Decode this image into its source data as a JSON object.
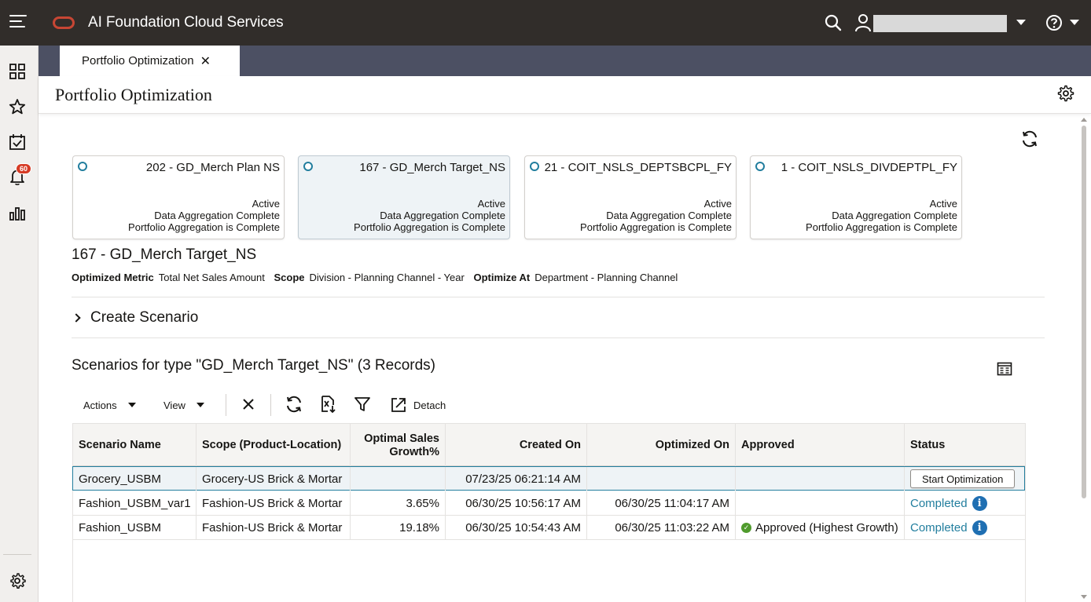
{
  "app": {
    "title": "AI Foundation Cloud Services"
  },
  "header": {
    "user_name": ""
  },
  "tabs": [
    {
      "label": "Portfolio Optimization",
      "close": "✕"
    }
  ],
  "page": {
    "title": "Portfolio Optimization"
  },
  "notifications": {
    "count": "60"
  },
  "cards": [
    {
      "title": "202 - GD_Merch Plan NS",
      "status1": "Active",
      "status2": "Data Aggregation Complete",
      "status3": "Portfolio Aggregation is Complete",
      "selected": false
    },
    {
      "title": "167 - GD_Merch Target_NS",
      "status1": "Active",
      "status2": "Data Aggregation Complete",
      "status3": "Portfolio Aggregation is Complete",
      "selected": true
    },
    {
      "title": "21 - COIT_NSLS_DEPTSBCPL_FY",
      "status1": "Active",
      "status2": "Data Aggregation Complete",
      "status3": "Portfolio Aggregation is Complete",
      "selected": false
    },
    {
      "title": "1 - COIT_NSLS_DIVDEPTPL_FY",
      "status1": "Active",
      "status2": "Data Aggregation Complete",
      "status3": "Portfolio Aggregation is Complete",
      "selected": false
    }
  ],
  "selected": {
    "title": "167 - GD_Merch Target_NS",
    "metric_label": "Optimized Metric",
    "metric_value": "Total Net Sales Amount",
    "scope_label": "Scope",
    "scope_value": "Division - Planning Channel - Year",
    "optimize_label": "Optimize At",
    "optimize_value": "Department - Planning Channel"
  },
  "create_scenario": {
    "label": "Create Scenario"
  },
  "scenarios": {
    "title": "Scenarios for type \"GD_Merch Target_NS\" (3 Records)",
    "toolbar": {
      "actions": "Actions",
      "view": "View",
      "detach": "Detach"
    },
    "columns": [
      "Scenario Name",
      "Scope (Product-Location)",
      "Optimal Sales Growth%",
      "Created On",
      "Optimized On",
      "Approved",
      "Status"
    ],
    "rows": [
      {
        "name": "Grocery_USBM",
        "scope": "Grocery-US Brick & Mortar",
        "growth": "",
        "created": "07/23/25 06:21:14 AM",
        "optimized": "",
        "approved": "",
        "status": "Start Optimization"
      },
      {
        "name": "Fashion_USBM_var1",
        "scope": "Fashion-US Brick & Mortar",
        "growth": "3.65%",
        "created": "06/30/25 10:56:17 AM",
        "optimized": "06/30/25 11:04:17 AM",
        "approved": "",
        "status": "Completed"
      },
      {
        "name": "Fashion_USBM",
        "scope": "Fashion-US Brick & Mortar",
        "growth": "19.18%",
        "created": "06/30/25 10:54:43 AM",
        "optimized": "06/30/25 11:03:22 AM",
        "approved": "Approved (Highest Growth)",
        "status": "Completed"
      }
    ]
  },
  "colors": {
    "topbar": "#312d2a",
    "brand": "#c74634",
    "accent": "#227e9e",
    "tabstrip": "#4c5063",
    "badge": "#d63b25",
    "success": "#509b2d"
  }
}
